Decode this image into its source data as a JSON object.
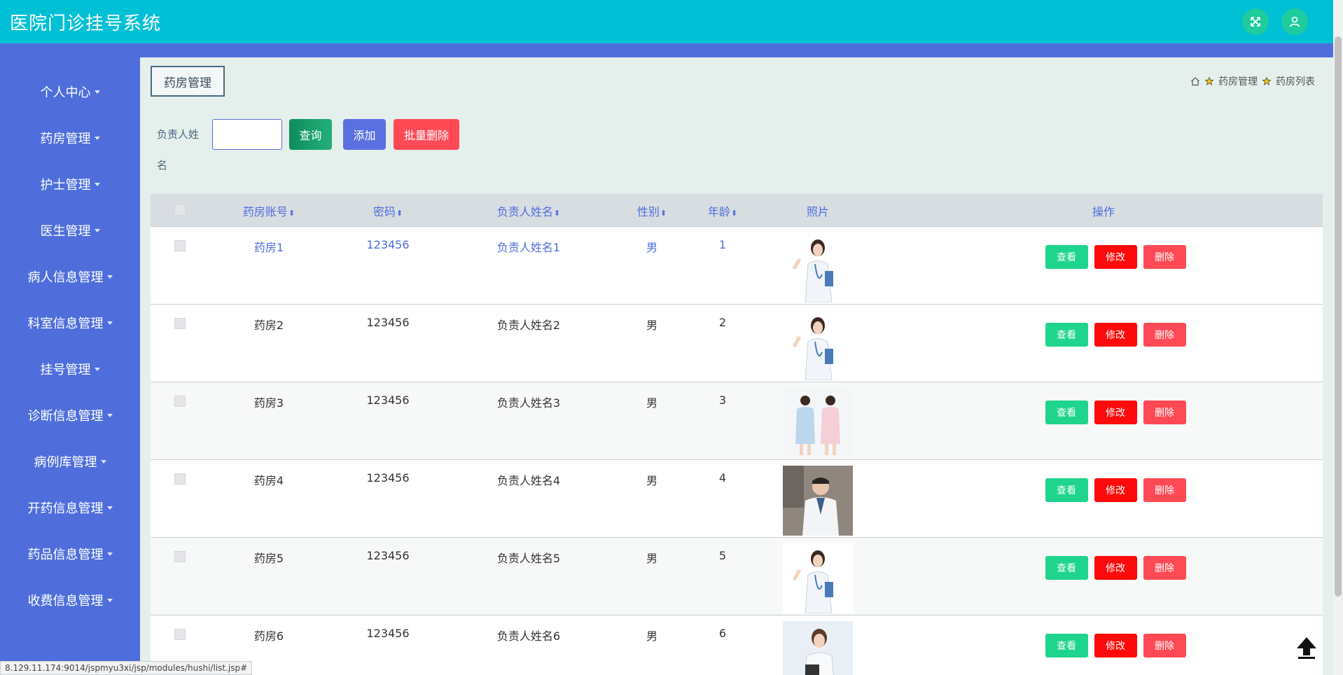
{
  "app": {
    "title": "医院门诊挂号系统"
  },
  "sidebar": {
    "items": [
      {
        "label": "个人中心"
      },
      {
        "label": "药房管理"
      },
      {
        "label": "护士管理"
      },
      {
        "label": "医生管理"
      },
      {
        "label": "病人信息管理"
      },
      {
        "label": "科室信息管理"
      },
      {
        "label": "挂号管理"
      },
      {
        "label": "诊断信息管理"
      },
      {
        "label": "病例库管理"
      },
      {
        "label": "开药信息管理"
      },
      {
        "label": "药品信息管理"
      },
      {
        "label": "收费信息管理"
      }
    ]
  },
  "page": {
    "tag": "药房管理",
    "breadcrumb": [
      "药房管理",
      "药房列表"
    ]
  },
  "search": {
    "label": "负责人姓名",
    "query_button": "查询",
    "add_button": "添加",
    "batch_delete_button": "批量删除"
  },
  "table": {
    "headers": {
      "account": "药房账号",
      "password": "密码",
      "name": "负责人姓名",
      "sex": "性别",
      "age": "年龄",
      "photo": "照片",
      "ops": "操作"
    },
    "rows": [
      {
        "account": "药房1",
        "password": "123456",
        "name": "负责人姓名1",
        "sex": "男",
        "age": "1",
        "photo": "doctor-female-photo"
      },
      {
        "account": "药房2",
        "password": "123456",
        "name": "负责人姓名2",
        "sex": "男",
        "age": "2",
        "photo": "doctor-female-photo"
      },
      {
        "account": "药房3",
        "password": "123456",
        "name": "负责人姓名3",
        "sex": "男",
        "age": "3",
        "photo": "two-nurses-photo"
      },
      {
        "account": "药房4",
        "password": "123456",
        "name": "负责人姓名4",
        "sex": "男",
        "age": "4",
        "photo": "doctor-male-photo"
      },
      {
        "account": "药房5",
        "password": "123456",
        "name": "负责人姓名5",
        "sex": "男",
        "age": "5",
        "photo": "doctor-female-photo"
      },
      {
        "account": "药房6",
        "password": "123456",
        "name": "负责人姓名6",
        "sex": "男",
        "age": "6",
        "photo": "doctor-clipboard-photo"
      }
    ],
    "ops": {
      "view": "查看",
      "edit": "修改",
      "delete": "删除"
    }
  },
  "status_url": "8.129.11.174:9014/jspmyu3xi/jsp/modules/hushi/list.jsp#",
  "colors": {
    "topbar": "#00c0d6",
    "sidebar": "#4f6edc",
    "view": "#1fd48c",
    "edit": "#ff0a0a",
    "delete": "#ff4a55"
  }
}
